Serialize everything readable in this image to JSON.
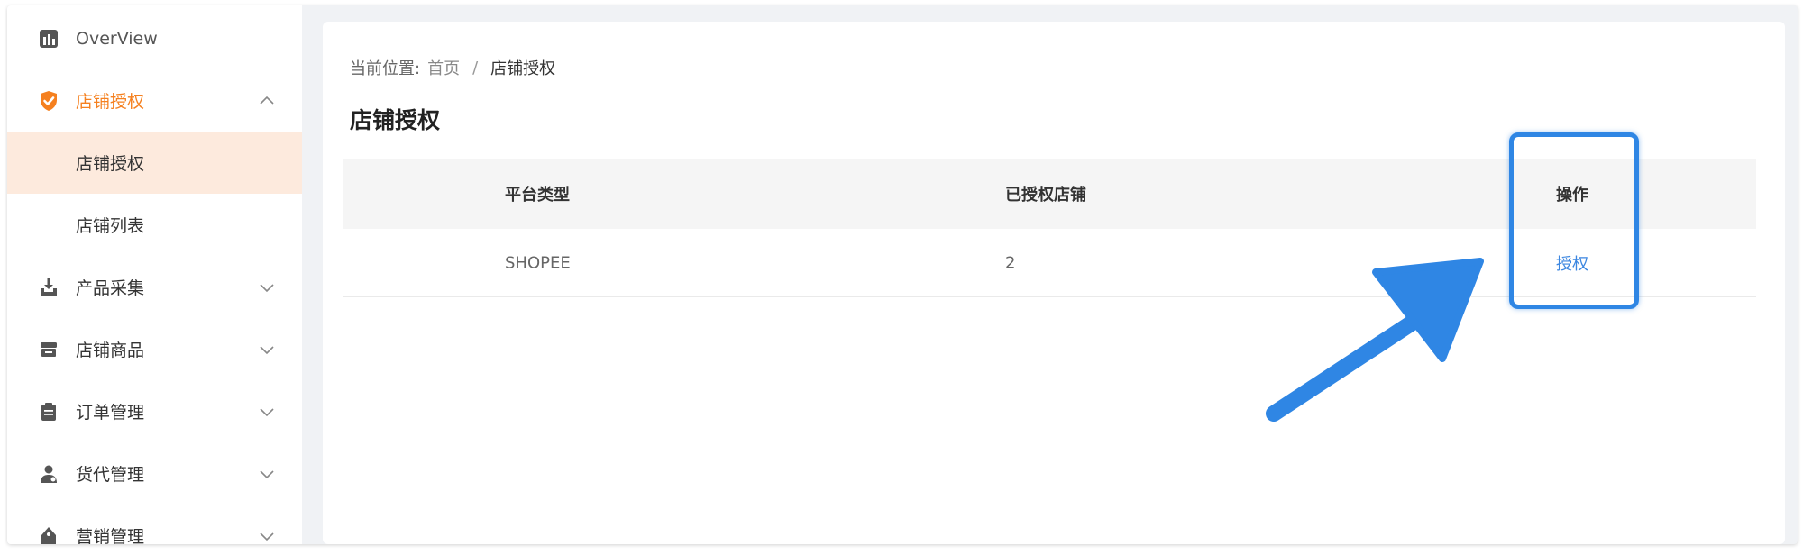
{
  "sidebar": {
    "items": [
      {
        "label": "OverView",
        "icon": "bar-chart-icon"
      },
      {
        "label": "店铺授权",
        "icon": "shield-check-icon",
        "expanded": true,
        "sub": [
          {
            "label": "店铺授权",
            "selected": true
          },
          {
            "label": "店铺列表"
          }
        ]
      },
      {
        "label": "产品采集",
        "icon": "download-icon"
      },
      {
        "label": "店铺商品",
        "icon": "store-icon"
      },
      {
        "label": "订单管理",
        "icon": "clipboard-icon"
      },
      {
        "label": "货代管理",
        "icon": "user-icon"
      },
      {
        "label": "营销管理",
        "icon": "tag-icon"
      }
    ]
  },
  "breadcrumb": {
    "prefix": "当前位置:",
    "home": "首页",
    "separator": "/",
    "current": "店铺授权"
  },
  "page": {
    "title": "店铺授权"
  },
  "table": {
    "headers": [
      "平台类型",
      "已授权店铺",
      "操作"
    ],
    "rows": [
      {
        "platform": "SHOPEE",
        "count": "2",
        "action": "授权"
      }
    ]
  },
  "colors": {
    "accent": "#f5801f",
    "selected_bg": "#fdeadd",
    "link": "#3b86e0",
    "annotation": "#2f86e4"
  }
}
